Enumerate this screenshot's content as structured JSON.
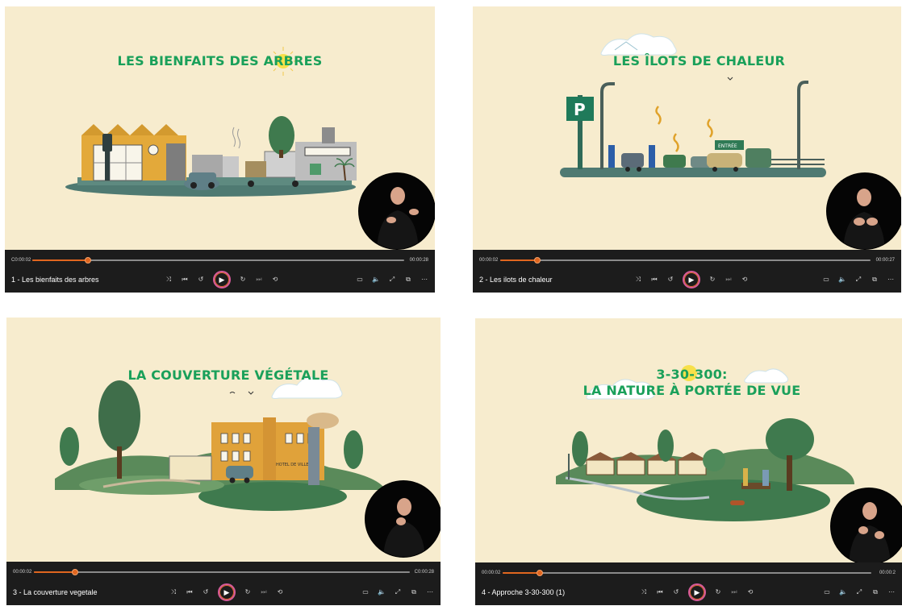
{
  "colors": {
    "background": "#f7ecce",
    "title_green": "#1aa05a",
    "progress_accent": "#e0661f",
    "controls_bg": "#1c1c1c"
  },
  "icons": {
    "shuffle": "⤨",
    "previous": "⏮",
    "rewind": "↺",
    "play": "▶",
    "forward": "↻",
    "next": "⏭",
    "repeat": "⟲",
    "miniplayer": "▭",
    "volume": "🔈",
    "fullscreen": "⤢",
    "cast": "⧉",
    "more": "⋯"
  },
  "players": [
    {
      "video_title": [
        "LES BIENFAITS DES ARBRES"
      ],
      "current_time": "C0:00:02",
      "total_time": "00:00:28",
      "progress": 0.15,
      "clip_title": "1 - Les bienfaits des arbres"
    },
    {
      "video_title": [
        "LES ÎLOTS DE CHALEUR"
      ],
      "sign_label": "ENTRÉE",
      "current_time": "00:00:02",
      "total_time": "00:00:27",
      "progress": 0.1,
      "clip_title": "2 - Les ilots de chaleur"
    },
    {
      "video_title": [
        "LA COUVERTURE VÉGÉTALE"
      ],
      "sign_label": "HOTEL DE VILLE",
      "current_time": "00:00:02",
      "total_time": "C0:00:28",
      "progress": 0.11,
      "clip_title": "3 - La couverture vegetale"
    },
    {
      "video_title": [
        "3-30-300:",
        "LA NATURE À PORTÉE DE VUE"
      ],
      "current_time": "00:00:02",
      "total_time": "00:00:2",
      "progress": 0.1,
      "clip_title": "4 - Approche 3-30-300 (1)"
    }
  ]
}
